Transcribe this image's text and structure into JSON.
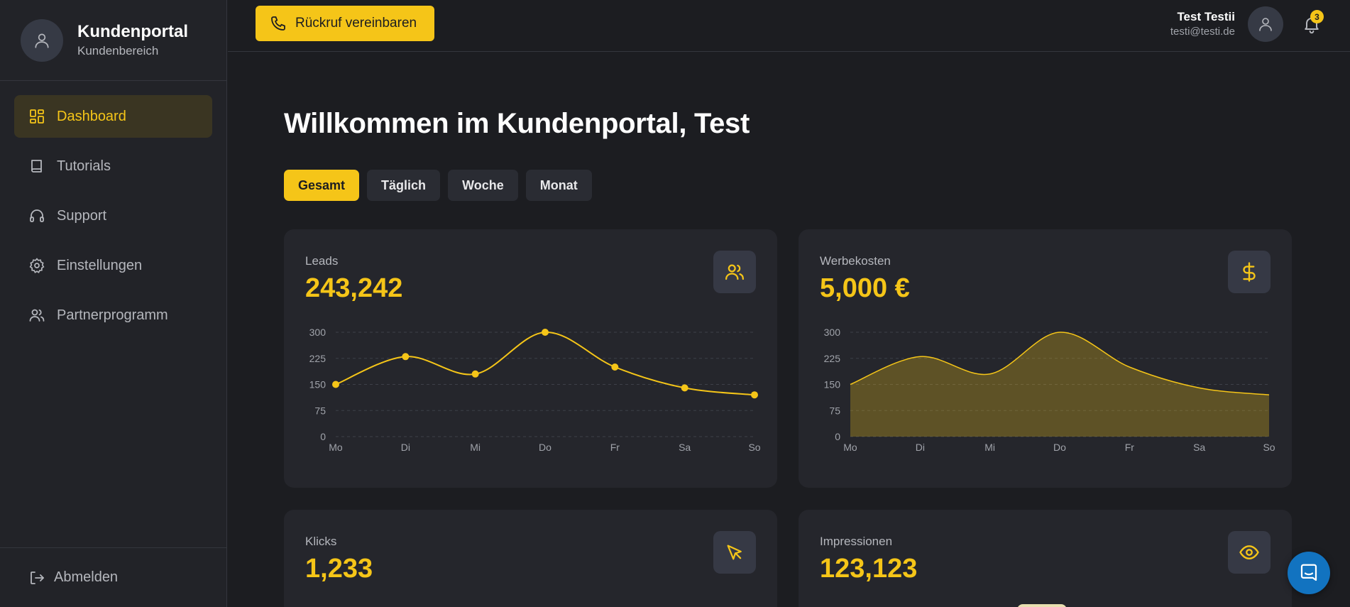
{
  "brand": {
    "title": "Kundenportal",
    "subtitle": "Kundenbereich",
    "icon": "user-icon"
  },
  "nav": {
    "items": [
      {
        "label": "Dashboard",
        "icon": "dashboard-icon",
        "active": true
      },
      {
        "label": "Tutorials",
        "icon": "book-icon"
      },
      {
        "label": "Support",
        "icon": "headphones-icon"
      },
      {
        "label": "Einstellungen",
        "icon": "gear-icon"
      },
      {
        "label": "Partnerprogramm",
        "icon": "users-icon"
      }
    ],
    "logout": "Abmelden"
  },
  "topbar": {
    "callback_label": "Rückruf vereinbaren",
    "user_name": "Test Testii",
    "user_email": "testi@testi.de",
    "notifications": "3"
  },
  "main": {
    "title": "Willkommen im Kundenportal, Test",
    "tabs": [
      "Gesamt",
      "Täglich",
      "Woche",
      "Monat"
    ],
    "active_tab": "Gesamt"
  },
  "cards": [
    {
      "label": "Leads",
      "value": "243,242",
      "icon": "users-icon"
    },
    {
      "label": "Werbekosten",
      "value": "5,000 €",
      "icon": "dollar-icon"
    },
    {
      "label": "Klicks",
      "value": "1,233",
      "icon": "cursor-icon"
    },
    {
      "label": "Impressionen",
      "value": "123,123",
      "icon": "eye-icon"
    }
  ],
  "colors": {
    "accent": "#f5c518",
    "background": "#1c1d21",
    "card": "#25262c",
    "chat": "#1273c0"
  },
  "chart_data": [
    {
      "type": "line",
      "categories": [
        "Mo",
        "Di",
        "Mi",
        "Do",
        "Fr",
        "Sa",
        "So"
      ],
      "series": [
        {
          "values": [
            150,
            230,
            180,
            300,
            200,
            140,
            120
          ]
        }
      ],
      "yticks": [
        0,
        75,
        150,
        225,
        300
      ],
      "ylim": [
        0,
        300
      ],
      "grid": true
    },
    {
      "type": "area",
      "categories": [
        "Mo",
        "Di",
        "Mi",
        "Do",
        "Fr",
        "Sa",
        "So"
      ],
      "series": [
        {
          "values": [
            150,
            230,
            180,
            300,
            200,
            140,
            120
          ]
        }
      ],
      "yticks": [
        0,
        75,
        150,
        225,
        300
      ],
      "ylim": [
        0,
        300
      ],
      "grid": true
    }
  ]
}
